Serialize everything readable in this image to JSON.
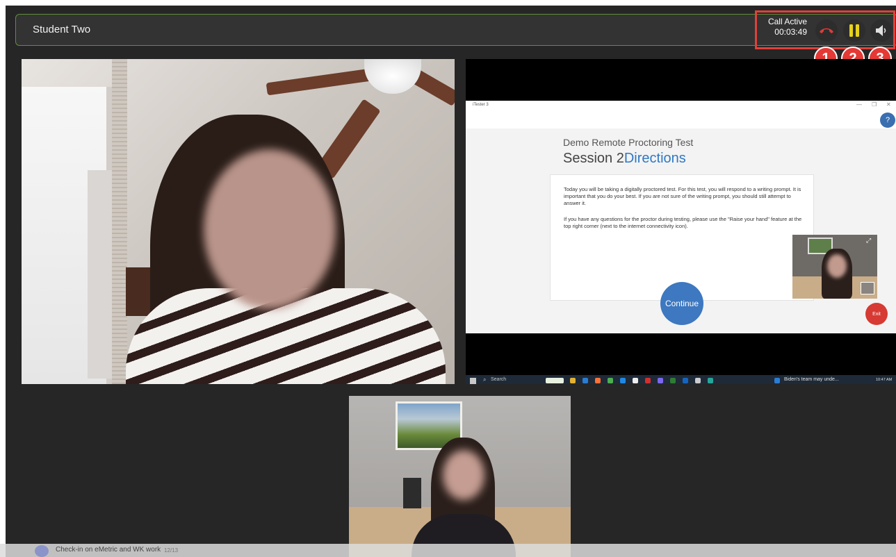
{
  "header": {
    "student_name": "Student Two",
    "call_status": "Call Active",
    "call_timer": "00:03:49"
  },
  "controls": [
    {
      "name": "end-call",
      "icon": "phone-hangup-icon",
      "color": "#e53935"
    },
    {
      "name": "pause",
      "icon": "pause-icon",
      "color": "#e6d21a"
    },
    {
      "name": "mute",
      "icon": "speaker-icon",
      "color": "#e0e0e0"
    }
  ],
  "badges": [
    "1",
    "2",
    "3"
  ],
  "screen_share": {
    "app_name": "iTester 3",
    "window_controls": [
      "—",
      "❐",
      "✕"
    ],
    "help_label": "?",
    "test_title": "Demo Remote Proctoring Test",
    "session_prefix": "Session 2",
    "session_suffix": "Directions",
    "paragraph_1": "Today you will be taking a digitally proctored test. For this test, you will respond to a writing prompt. It is important that you do your best. If you are not sure of the writing prompt, you should still attempt to answer it.",
    "paragraph_2": "If you have any questions for the proctor during testing, please use the \"Raise your hand\" feature at the top right corner (next to the internet connectivity icon).",
    "continue_label": "Continue",
    "exit_label": "Exit",
    "taskbar": {
      "search": "Search",
      "news": "Biden's team may unde...",
      "time": "10:47 AM"
    }
  },
  "footer": {
    "text": "Check-in on eMetric and WK work",
    "date": "12/13"
  },
  "colors": {
    "alert_red": "#e53935",
    "header_border": "#5f8f3a",
    "accent_blue": "#2f78c4"
  }
}
